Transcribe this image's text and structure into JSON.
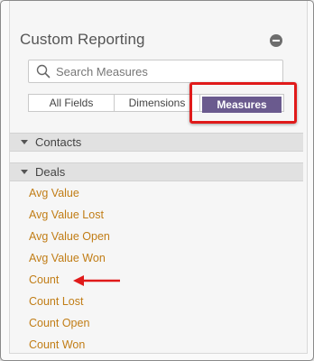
{
  "panel": {
    "title": "Custom Reporting"
  },
  "search": {
    "placeholder": "Search Measures"
  },
  "tabs": [
    {
      "label": "All Fields",
      "selected": false
    },
    {
      "label": "Dimensions",
      "selected": false
    },
    {
      "label": "Measures",
      "selected": true
    }
  ],
  "sections": [
    {
      "label": "Contacts"
    },
    {
      "label": "Deals"
    }
  ],
  "deal_fields": [
    "Avg Value",
    "Avg Value Lost",
    "Avg Value Open",
    "Avg Value Won",
    "Count",
    "Count Lost",
    "Count Open",
    "Count Won"
  ],
  "colors": {
    "accent_tab": "#6a5a8e",
    "field_link": "#c17d16",
    "annotation": "#e01a1a"
  }
}
